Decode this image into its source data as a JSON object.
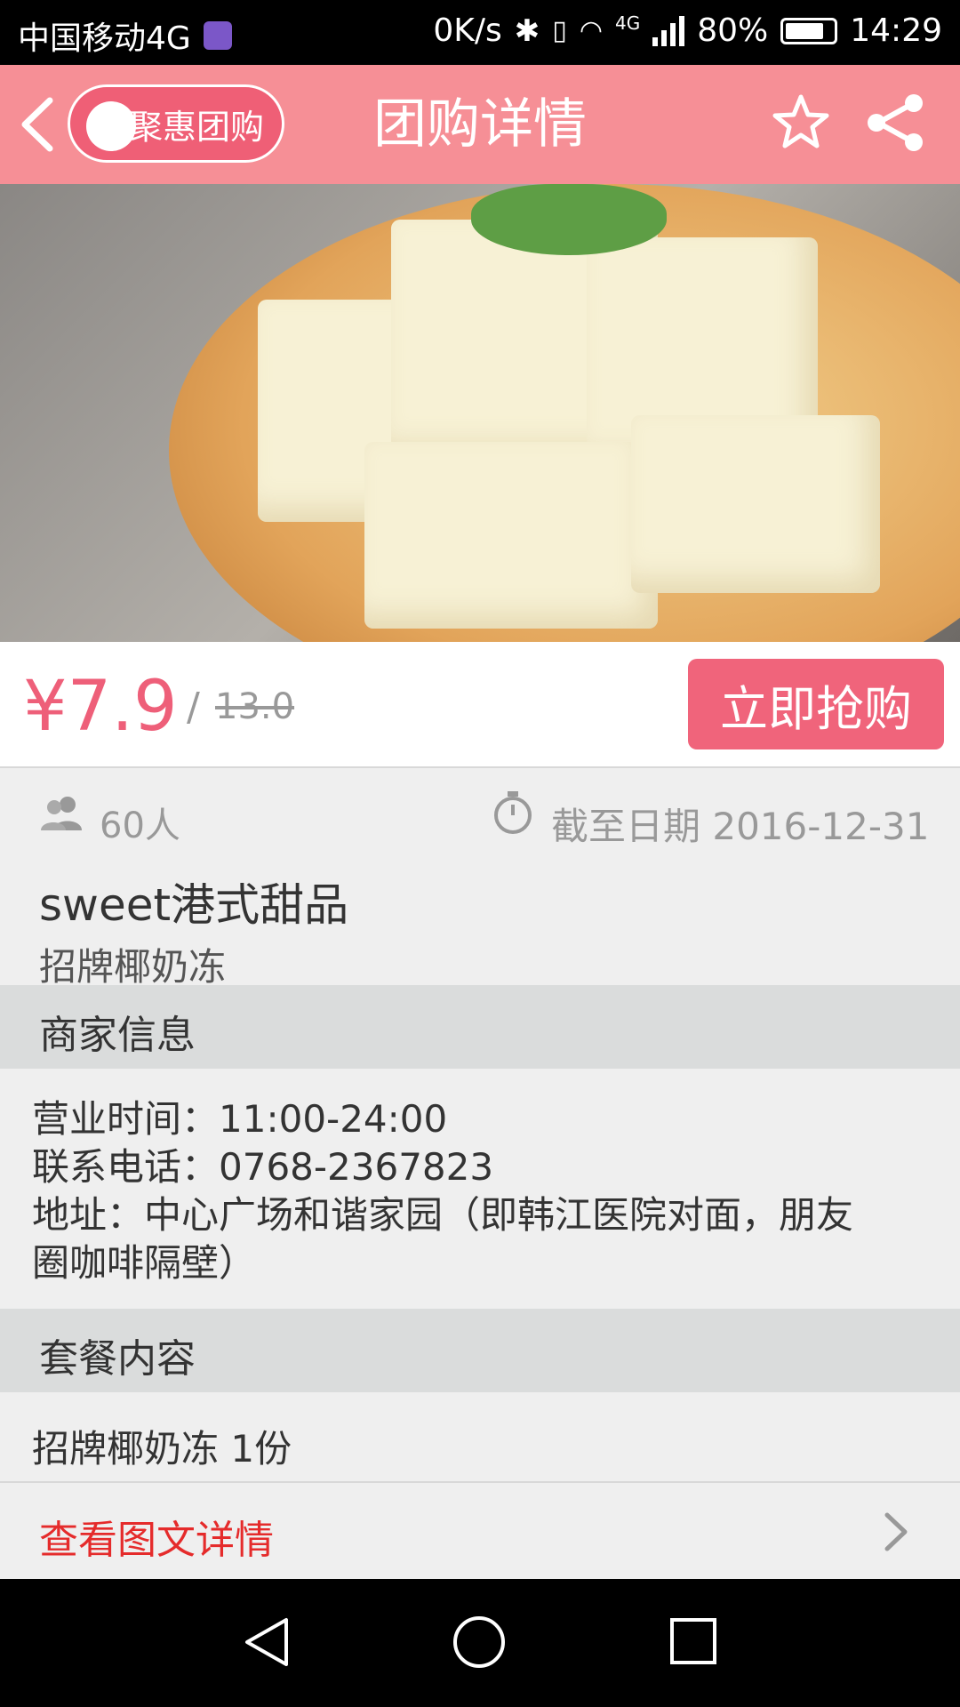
{
  "status_bar": {
    "carrier": "中国移动4G",
    "speed": "0K/s",
    "network": "4G",
    "battery": "80%",
    "time": "14:29"
  },
  "header": {
    "brand": "聚惠团购",
    "title": "团购详情",
    "icons": [
      "back-arrow-icon",
      "star-icon",
      "share-icon"
    ]
  },
  "deal": {
    "price": "¥7.9",
    "slash": "/",
    "original_price": "13.0",
    "buy_label": "立即抢购",
    "people": "60人",
    "deadline": "截至日期 2016-12-31",
    "store": "sweet港式甜品",
    "item": "招牌椰奶冻"
  },
  "merchant": {
    "section_title": "商家信息",
    "hours": "营业时间：11:00-24:00",
    "phone": "联系电话：0768-2367823",
    "address_line1": "地址：中心广场和谐家园（即韩江医院对面，朋友",
    "address_line2": "圈咖啡隔壁）"
  },
  "package": {
    "section_title": "套餐内容",
    "content": "招牌椰奶冻 1份"
  },
  "detail_link": {
    "label": "查看图文详情"
  },
  "colors": {
    "header_bg": "#f68f96",
    "accent": "#f0647b",
    "price": "#ee5f79",
    "link": "#e52b2b"
  }
}
